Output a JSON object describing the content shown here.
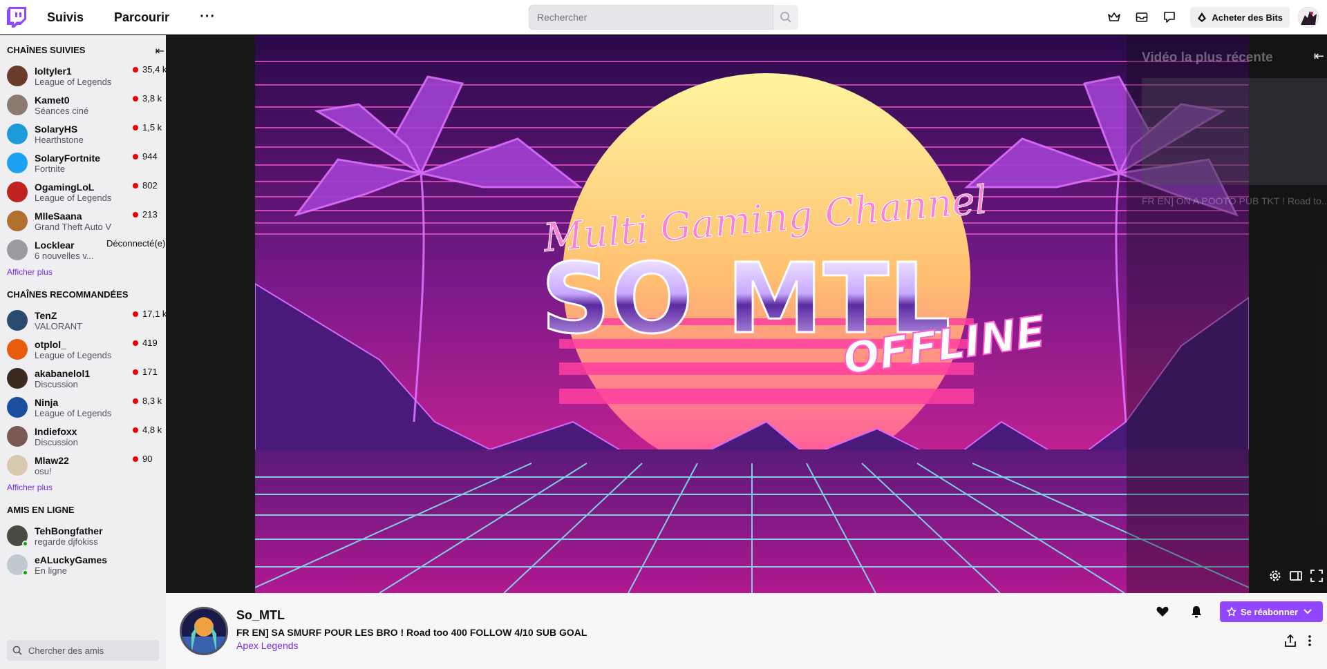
{
  "topnav": {
    "following": "Suivis",
    "browse": "Parcourir",
    "more": "···",
    "search_placeholder": "Rechercher",
    "bits_label": "Acheter des Bits"
  },
  "sidebar": {
    "followed_title": "CHAÎNES SUIVIES",
    "followed": [
      {
        "name": "loltyler1",
        "game": "League of Legends",
        "viewers": "35,4 k",
        "color": "#6b3b2a"
      },
      {
        "name": "Kamet0",
        "game": "Séances ciné",
        "viewers": "3,8 k",
        "color": "#8a7a70"
      },
      {
        "name": "SolaryHS",
        "game": "Hearthstone",
        "viewers": "1,5 k",
        "color": "#1d9bd8"
      },
      {
        "name": "SolaryFortnite",
        "game": "Fortnite",
        "viewers": "944",
        "color": "#1da1f2"
      },
      {
        "name": "OgamingLoL",
        "game": "League of Legends",
        "viewers": "802",
        "color": "#c0231f"
      },
      {
        "name": "MlleSaana",
        "game": "Grand Theft Auto V",
        "viewers": "213",
        "color": "#b07030"
      },
      {
        "name": "Locklear",
        "game": "6 nouvelles v...",
        "viewers": "",
        "color": "#9a9aa0"
      }
    ],
    "offline_label": "Déconnecté(e)",
    "show_more": "Afficher plus",
    "recommended_title": "CHAÎNES RECOMMANDÉES",
    "recommended": [
      {
        "name": "TenZ",
        "game": "VALORANT",
        "viewers": "17,1 k",
        "color": "#2a4a70"
      },
      {
        "name": "otplol_",
        "game": "League of Legends",
        "viewers": "419",
        "color": "#e85c0d"
      },
      {
        "name": "akabanelol1",
        "game": "Discussion",
        "viewers": "171",
        "color": "#3a2a20"
      },
      {
        "name": "Ninja",
        "game": "League of Legends",
        "viewers": "8,3 k",
        "color": "#1a4fa0"
      },
      {
        "name": "Indiefoxx",
        "game": "Discussion",
        "viewers": "4,8 k",
        "color": "#7a5a50"
      },
      {
        "name": "Mlaw22",
        "game": "osu!",
        "viewers": "90",
        "color": "#d8c8b0"
      }
    ],
    "show_more_2": "Afficher plus",
    "friends_title": "AMIS EN LIGNE",
    "friends": [
      {
        "name": "TehBongfather",
        "status": "regarde djfokiss",
        "color": "#4a4a40"
      },
      {
        "name": "eALuckyGames",
        "status": "En ligne",
        "color": "#c0c8d0"
      }
    ],
    "friends_search_placeholder": "Chercher des amis"
  },
  "banner": {
    "script_title": "Multi Gaming Channel",
    "main_title": "SO MTL",
    "offline_text": "OFFLINE"
  },
  "video_panel": {
    "title": "Vidéo la plus récente",
    "desc": "FR EN] ON A POOTO PUB TKT ! Road to..."
  },
  "channel": {
    "name": "So_MTL",
    "stream_title": "FR EN] SA SMURF POUR LES BRO ! Road too 400 FOLLOW 4/10 SUB GOAL",
    "game": "Apex Legends",
    "resub_label": "Se réabonner"
  },
  "colors": {
    "accent": "#9147ff",
    "live": "#eb0400",
    "link": "#772ce8"
  }
}
